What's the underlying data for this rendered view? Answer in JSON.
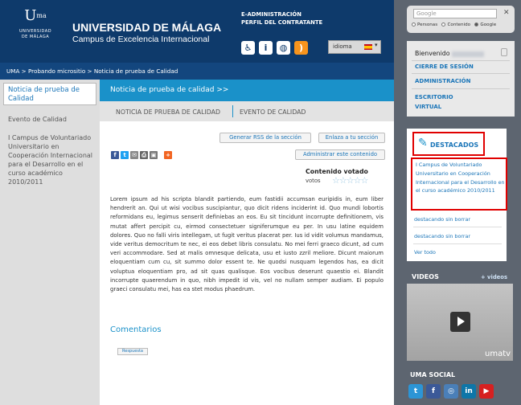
{
  "header": {
    "logo": {
      "mark": "U",
      "mark_sup": "ma",
      "name_line1": "UNIVERSIDAD",
      "name_line2": "DE MÁLAGA"
    },
    "title": "UNIVERSIDAD DE MÁLAGA",
    "subtitle": "Campus de Excelencia Internacional",
    "top_links": [
      "E-ADMINISTRACIÓN",
      "PERFIL DEL CONTRATANTE"
    ],
    "language_label": "idioma",
    "icons": [
      "accessibility-icon",
      "info-icon",
      "web-icon",
      "rss-icon"
    ]
  },
  "breadcrumb": "UMA > Probando micrositio > Noticia de prueba de Calidad",
  "leftnav": {
    "active": "Noticia de prueba de Calidad",
    "items": [
      "Evento de Calidad",
      "I Campus de Voluntariado Universitario en Cooperación Internacional para el Desarrollo en el curso académico 2010/2011"
    ]
  },
  "content": {
    "section_title": "Noticia de prueba de calidad >>",
    "tabs": [
      "NOTICIA DE PRUEBA DE CALIDAD",
      "EVENTO DE CALIDAD"
    ],
    "rss_button": "Generar RSS de la sección",
    "link_button": "Enlaza a tu sección",
    "admin_button": "Administrar este contenido",
    "voted_title": "Contenido votado",
    "votes_label": "votos",
    "body": "Lorem ipsum ad his scripta blandit partiendo, eum fastidii accumsan euripidis in, eum liber hendrerit an. Qui ut wisi vocibus suscipiantur, quo dicit ridens inciderint id. Quo mundi lobortis reformidans eu, legimus senserit definiebas an eos. Eu sit tincidunt incorrupte definitionem, vis mutat affert percipit cu, eirmod consectetuer signiferumque eu per. In usu latine equidem dolores. Quo no falli viris intellegam, ut fugit veritus placerat per. Ius id vidit volumus mandamus, vide veritus democritum te nec, ei eos debet libris consulatu. No mei ferri graeco dicunt, ad cum veri accommodare. Sed at malis omnesque delicata, usu et iusto zzril meliore. Dicunt maiorum eloquentiam cum cu, sit summo dolor essent te. Ne quodsi nusquam legendos has, ea dicit voluptua eloquentiam pro, ad sit quas qualisque. Eos vocibus deserunt quaestio ei. Blandit incorrupte quaerendum in quo, nibh impedit id vis, vel no nullam semper audiam. Ei populo graeci consulatu mei, has ea stet modus phaedrum.",
    "comments_title": "Comentarios",
    "reply_button": "Respuesta"
  },
  "right": {
    "search_placeholder": "Google",
    "search_options": [
      "Personas",
      "Contenido",
      "Google"
    ],
    "welcome": "Bienvenido",
    "links": [
      "CIERRE DE SESIÓN",
      "ADMINISTRACIÓN",
      "ESCRITORIO",
      "VIRTUAL"
    ],
    "destacados_title": "DESTACADOS",
    "featured": "I Campus de Voluntariado Universitario en Cooperación Internacional para el Desarrollo en el curso académico 2010/2011",
    "dest_links": [
      "destacando sin borrar",
      "destacando sin borrar",
      "Ver todo"
    ],
    "videos_title": "VIDEOS",
    "videos_more": "+ videos",
    "umatv": "umatv",
    "social_title": "UMA SOCIAL"
  },
  "colors": {
    "header_blue": "#0e3a6b",
    "section_blue": "#1a91c9",
    "highlight_red": "#e00000",
    "sidebar_gray": "#5d6570"
  }
}
